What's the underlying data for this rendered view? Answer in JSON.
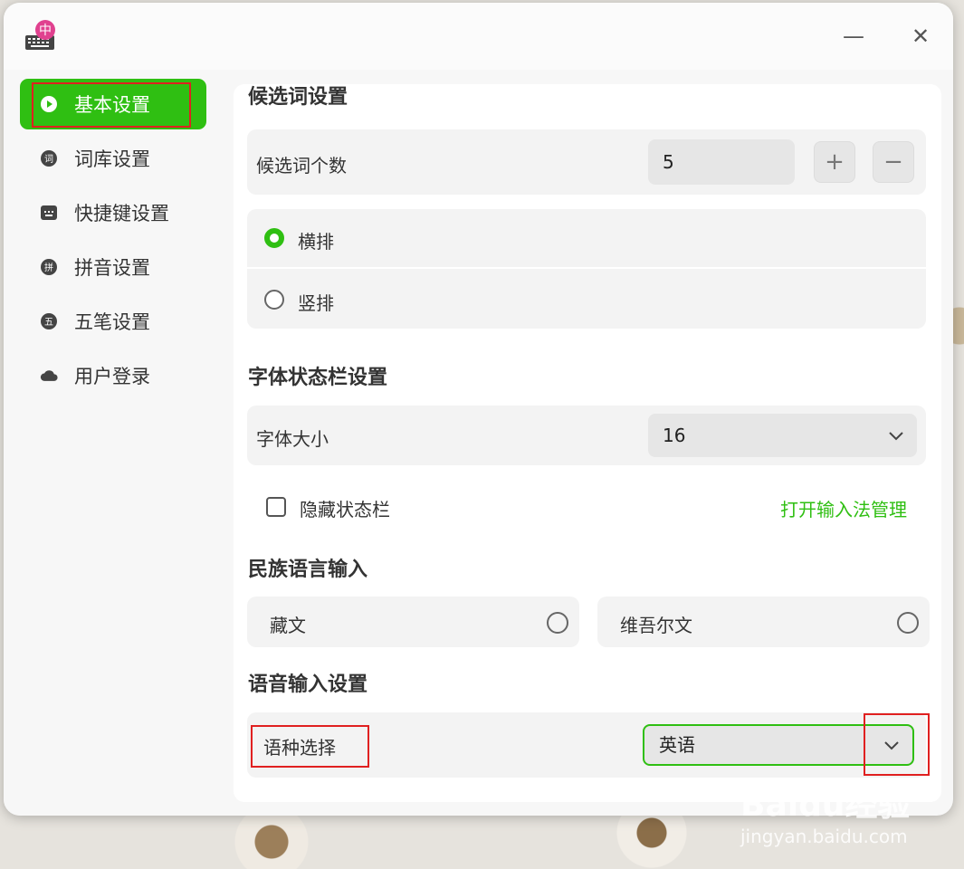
{
  "window": {
    "minimize_glyph": "—",
    "close_glyph": "✕"
  },
  "sidebar": {
    "items": [
      {
        "label": "基本设置",
        "icon": "play-icon"
      },
      {
        "label": "词库设置",
        "icon": "dictionary-icon"
      },
      {
        "label": "快捷键设置",
        "icon": "keyboard-icon"
      },
      {
        "label": "拼音设置",
        "icon": "pinyin-icon"
      },
      {
        "label": "五笔设置",
        "icon": "wubi-icon"
      },
      {
        "label": "用户登录",
        "icon": "cloud-icon"
      }
    ]
  },
  "candidate": {
    "section_title": "候选词设置",
    "count_label": "候选词个数",
    "count_value": "5",
    "plus": "+",
    "minus": "−",
    "layout_options": [
      {
        "label": "横排",
        "selected": true
      },
      {
        "label": "竖排",
        "selected": false
      }
    ]
  },
  "font_status": {
    "section_title": "字体状态栏设置",
    "size_label": "字体大小",
    "size_value": "16",
    "hide_status_label": "隐藏状态栏",
    "hide_status_checked": false,
    "open_manager_link": "打开输入法管理"
  },
  "ethnic": {
    "section_title": "民族语言输入",
    "options": [
      {
        "label": "藏文",
        "selected": false
      },
      {
        "label": "维吾尔文",
        "selected": false
      }
    ]
  },
  "voice": {
    "section_title": "语音输入设置",
    "language_label": "语种选择",
    "language_value": "英语"
  },
  "watermark": {
    "brand": "Baidu经验",
    "url": "jingyan.baidu.com"
  },
  "colors": {
    "accent": "#2fbf12",
    "annotation": "#e02020"
  }
}
